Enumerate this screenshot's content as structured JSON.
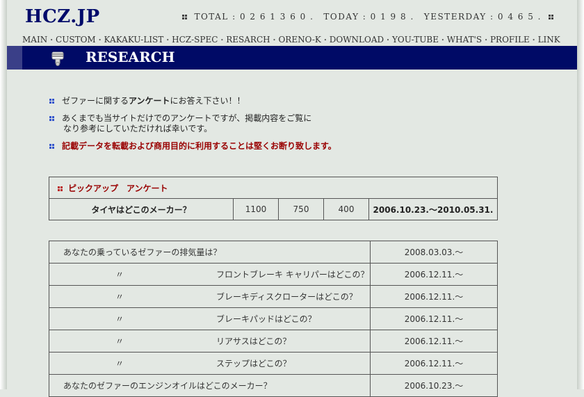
{
  "site": {
    "logo": "HCZ.JP",
    "counter": {
      "total": "TOTAL : 0 2 6 1 3 6 0 .",
      "today": "TODAY : 0 1 9 8 .",
      "yesterday": "YESTERDAY : 0 4 6 5 ."
    }
  },
  "nav": {
    "items": [
      {
        "label": "MAIN"
      },
      {
        "label": "CUSTOM"
      },
      {
        "label": "KAKAKU-LIST"
      },
      {
        "label": "HCZ-SPEC"
      },
      {
        "label": "RESARCH"
      },
      {
        "label": "ORENO-K"
      },
      {
        "label": "DOWNLOAD"
      },
      {
        "label": "YOU-TUBE"
      },
      {
        "label": "WHAT'S"
      },
      {
        "label": "PROFILE"
      },
      {
        "label": "LINK"
      }
    ],
    "separator": "・"
  },
  "banner": {
    "title": "RESEARCH",
    "icon": "piston-icon"
  },
  "intro": {
    "b1_pre": "ゼファーに関する",
    "b1_bold": "アンケート",
    "b1_post": "にお答え下さい！！",
    "b2_line1": "あくまでも当サイトだけでのアンケートですが、掲載内容をご覧に",
    "b2_line2": "なり参考にしていただければ幸いです。",
    "b3": "記載データを転載および商用目的に利用することは堅くお断り致します。"
  },
  "pickup": {
    "header": "ピックアップ　アンケート",
    "question": "タイヤはどこのメーカー？",
    "models": [
      "1100",
      "750",
      "400"
    ],
    "period": "2006.10.23.～2010.05.31."
  },
  "surveys": [
    {
      "ditto": "",
      "text": "あなたの乗っているゼファーの排気量は？",
      "date": "2008.03.03.～"
    },
    {
      "ditto": "〃",
      "text": "フロントブレーキ キャリパーはどこの？",
      "date": "2006.12.11.～"
    },
    {
      "ditto": "〃",
      "text": "ブレーキディスクローターはどこの？",
      "date": "2006.12.11.～"
    },
    {
      "ditto": "〃",
      "text": "ブレーキパッドはどこの？",
      "date": "2006.12.11.～"
    },
    {
      "ditto": "〃",
      "text": "リアサスはどこの？",
      "date": "2006.12.11.～"
    },
    {
      "ditto": "〃",
      "text": "ステップはどこの？",
      "date": "2006.12.11.～"
    },
    {
      "ditto": "",
      "text": "あなたのゼファーのエンジンオイルはどこのメーカー？",
      "date": "2006.10.23.～"
    }
  ],
  "colors": {
    "banner": "#000a66",
    "logo": "#000a6a",
    "warning": "#990000",
    "background": "#e3e8e3"
  }
}
